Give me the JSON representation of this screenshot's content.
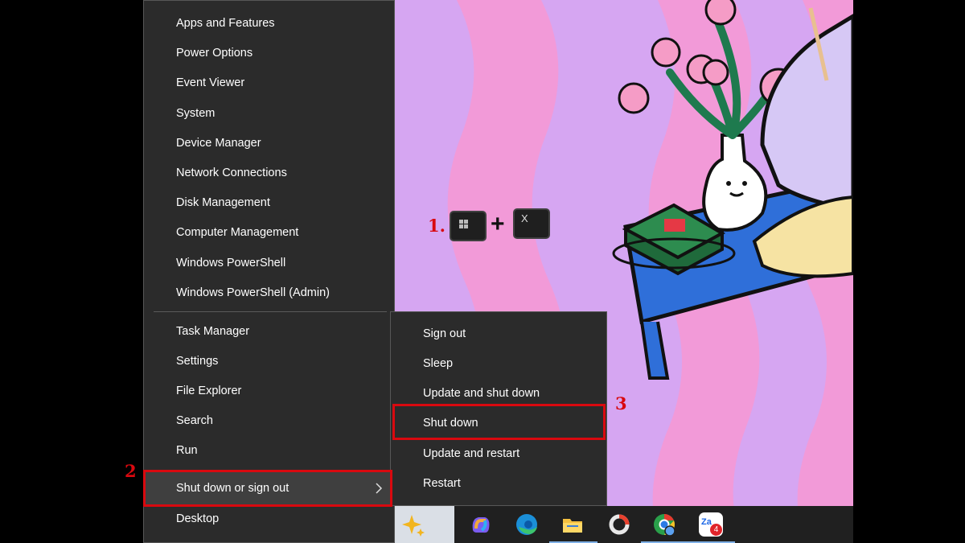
{
  "winx_menu": {
    "items": [
      {
        "label": "Apps and Features"
      },
      {
        "label": "Power Options"
      },
      {
        "label": "Event Viewer"
      },
      {
        "label": "System"
      },
      {
        "label": "Device Manager"
      },
      {
        "label": "Network Connections"
      },
      {
        "label": "Disk Management"
      },
      {
        "label": "Computer Management"
      },
      {
        "label": "Windows PowerShell"
      },
      {
        "label": "Windows PowerShell (Admin)"
      },
      {
        "label": "Task Manager"
      },
      {
        "label": "Settings"
      },
      {
        "label": "File Explorer"
      },
      {
        "label": "Search"
      },
      {
        "label": "Run"
      },
      {
        "label": "Shut down or sign out"
      },
      {
        "label": "Desktop"
      }
    ]
  },
  "submenu": {
    "items": [
      {
        "label": "Sign out"
      },
      {
        "label": "Sleep"
      },
      {
        "label": "Update and shut down"
      },
      {
        "label": "Shut down"
      },
      {
        "label": "Update and restart"
      },
      {
        "label": "Restart"
      }
    ]
  },
  "annotations": {
    "step1": "1.",
    "step2": "2",
    "step3": "3",
    "plus": "+",
    "key_x": "X"
  },
  "taskbar": {
    "zalo_badge": "4",
    "zalo_label": "Za"
  },
  "colors": {
    "menu_bg": "#2b2b2b",
    "highlight": "#d9090f",
    "taskbar_bg": "#202020"
  }
}
